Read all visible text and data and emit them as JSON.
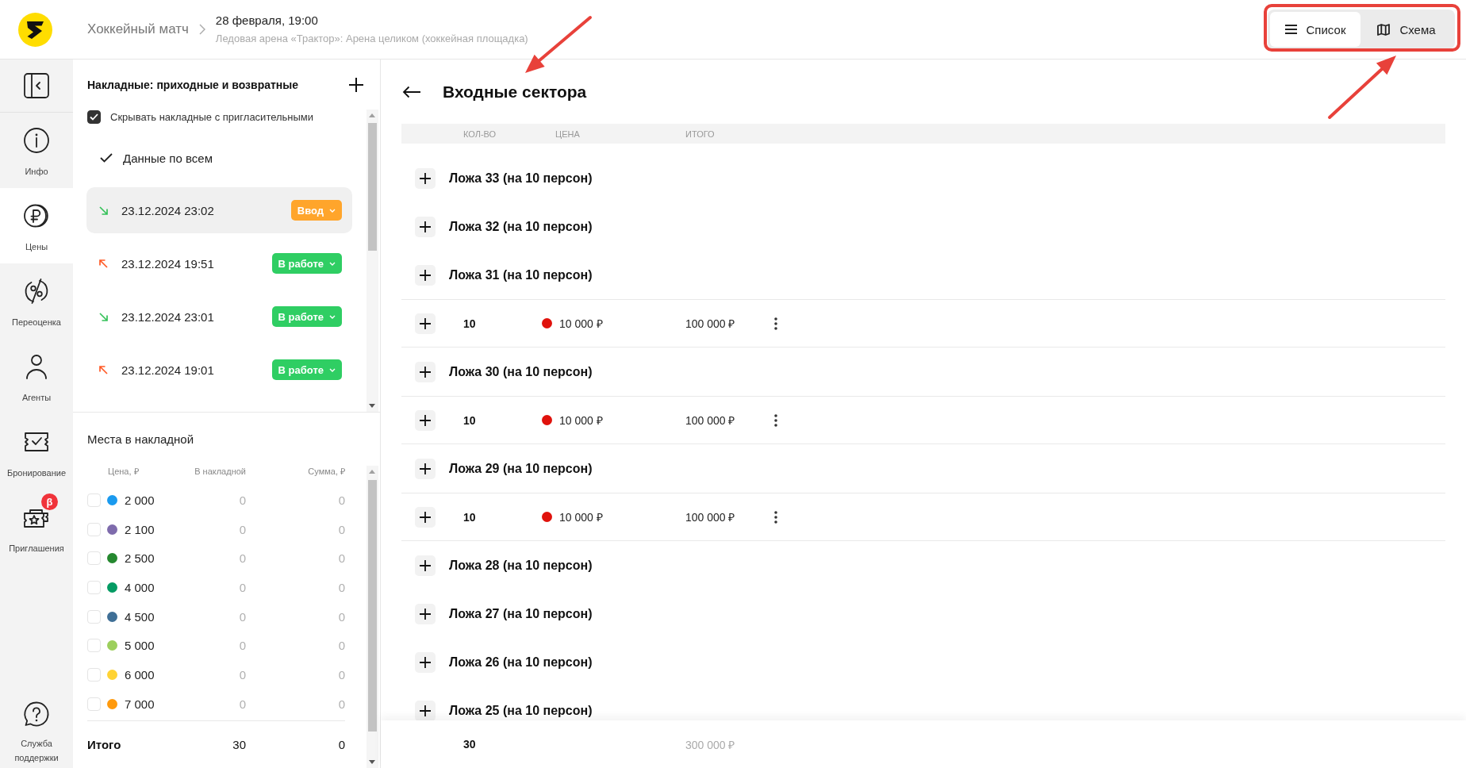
{
  "header": {
    "breadcrumb": "Хоккейный матч",
    "event_date": "28 февраля, 19:00",
    "venue": "Ледовая арена «Трактор»: Арена целиком (хоккейная площадка)",
    "view_switch": [
      {
        "label": "Список",
        "selected": true
      },
      {
        "label": "Схема",
        "selected": false
      }
    ]
  },
  "sidebar": {
    "items": [
      {
        "label": "Инфо",
        "selected": false
      },
      {
        "label": "Цены",
        "selected": true
      },
      {
        "label": "Переоценка",
        "selected": false
      },
      {
        "label": "Агенты",
        "selected": false
      },
      {
        "label": "Бронирование",
        "selected": false
      },
      {
        "label": "Приглашения",
        "selected": false,
        "badge": "β"
      }
    ],
    "support": "Служба поддержки"
  },
  "invoices": {
    "title": "Накладные: приходные и возвратные",
    "hide_invitations": {
      "label": "Скрывать накладные с пригласительными",
      "checked": true
    },
    "all_data": {
      "label": "Данные по всем",
      "checked": true
    },
    "items": [
      {
        "kind": "incoming",
        "date": "23.12.2024 23:02",
        "status": "Ввод",
        "color": "#ffa52b",
        "selected": true
      },
      {
        "kind": "return",
        "date": "23.12.2024 19:51",
        "status": "В работе",
        "color": "#2fce63",
        "selected": false
      },
      {
        "kind": "incoming",
        "date": "23.12.2024 23:01",
        "status": "В работе",
        "color": "#2fce63",
        "selected": false
      },
      {
        "kind": "return",
        "date": "23.12.2024 19:01",
        "status": "В работе",
        "color": "#2fce63",
        "selected": false
      }
    ]
  },
  "seats": {
    "title": "Места в накладной",
    "columns": [
      "Цена, ₽",
      "В накладной",
      "Сумма, ₽"
    ],
    "rows": [
      {
        "price": "2 000",
        "color": "#1a9aef",
        "checked": false,
        "in_invoice": "0",
        "sum": "0"
      },
      {
        "price": "2 100",
        "color": "#7e6bac",
        "checked": false,
        "in_invoice": "0",
        "sum": "0"
      },
      {
        "price": "2 500",
        "color": "#25882f",
        "checked": false,
        "in_invoice": "0",
        "sum": "0"
      },
      {
        "price": "4 000",
        "color": "#049b63",
        "checked": false,
        "in_invoice": "0",
        "sum": "0"
      },
      {
        "price": "4 500",
        "color": "#3f6f96",
        "checked": false,
        "in_invoice": "0",
        "sum": "0"
      },
      {
        "price": "5 000",
        "color": "#9ccf5c",
        "checked": false,
        "in_invoice": "0",
        "sum": "0"
      },
      {
        "price": "6 000",
        "color": "#ffd334",
        "checked": false,
        "in_invoice": "0",
        "sum": "0"
      },
      {
        "price": "7 000",
        "color": "#ff9a0d",
        "checked": false,
        "in_invoice": "0",
        "sum": "0"
      }
    ],
    "total": {
      "label": "Итого",
      "in_invoice": "30",
      "sum": "0"
    }
  },
  "sectors": {
    "title": "Входные сектора",
    "columns": [
      "КОЛ-ВО",
      "ЦЕНА",
      "ИТОГО"
    ],
    "rows": [
      {
        "kind": "sector",
        "label": "Ложа 33 (на 10 персон)"
      },
      {
        "kind": "sector",
        "label": "Ложа 32 (на 10 персон)"
      },
      {
        "kind": "sector",
        "label": "Ложа 31 (на 10 персон)"
      },
      {
        "kind": "price",
        "quantity": "10",
        "price": "10 000 ₽",
        "color": "#e0120c",
        "total": "100 000 ₽"
      },
      {
        "kind": "sector",
        "label": "Ложа 30 (на 10 персон)"
      },
      {
        "kind": "price",
        "quantity": "10",
        "price": "10 000 ₽",
        "color": "#e0120c",
        "total": "100 000 ₽"
      },
      {
        "kind": "sector",
        "label": "Ложа 29 (на 10 персон)"
      },
      {
        "kind": "price",
        "quantity": "10",
        "price": "10 000 ₽",
        "color": "#e0120c",
        "total": "100 000 ₽"
      },
      {
        "kind": "sector",
        "label": "Ложа 28 (на 10 персон)"
      },
      {
        "kind": "sector",
        "label": "Ложа 27 (на 10 персон)"
      },
      {
        "kind": "sector",
        "label": "Ложа 26 (на 10 персон)"
      },
      {
        "kind": "sector",
        "label": "Ложа 25 (на 10 персон)"
      }
    ],
    "footer": {
      "quantity": "30",
      "total": "300 000 ₽"
    }
  }
}
